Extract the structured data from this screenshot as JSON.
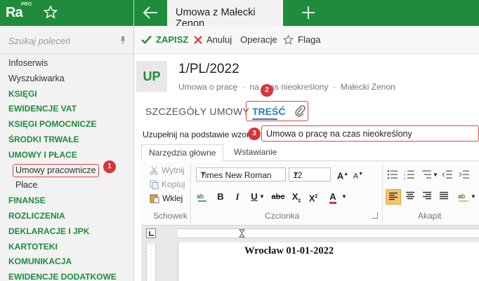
{
  "sidebar": {
    "logo": {
      "main": "Ra",
      "badge": "PRO"
    },
    "search_placeholder": "Szukaj poleceń",
    "items": [
      {
        "label": "Infoserwis",
        "style": "normal"
      },
      {
        "label": "Wyszukiwarka",
        "style": "normal"
      },
      {
        "label": "KSIĘGI",
        "style": "green"
      },
      {
        "label": "EWIDENCJE VAT",
        "style": "green"
      },
      {
        "label": "KSIĘGI POMOCNICZE",
        "style": "green"
      },
      {
        "label": "ŚRODKI TRWAŁE",
        "style": "green"
      },
      {
        "label": "UMOWY I PŁACE",
        "style": "green"
      },
      {
        "label": "Umowy pracownicze",
        "style": "sub-active"
      },
      {
        "label": "Płace",
        "style": "sub"
      },
      {
        "label": "FINANSE",
        "style": "green"
      },
      {
        "label": "ROZLICZENIA",
        "style": "green"
      },
      {
        "label": "DEKLARACJE I JPK",
        "style": "green"
      },
      {
        "label": "KARTOTEKI",
        "style": "green"
      },
      {
        "label": "KOMUNIKACJA",
        "style": "green"
      },
      {
        "label": "EWIDENCJE DODATKOWE",
        "style": "green"
      }
    ]
  },
  "tabs": {
    "active_tab": "Umowa z Małecki Zenon"
  },
  "toolbar": {
    "save": "ZAPISZ",
    "cancel": "Anuluj",
    "operations": "Operacje",
    "flag": "Flaga"
  },
  "header": {
    "badge": "UP",
    "number": "1/PL/2022",
    "subtitle_parts": [
      "Umowa o pracę",
      "na czas nieokreślony",
      "Małecki Zenon"
    ]
  },
  "section_tabs": {
    "details": "SZCZEGÓŁY UMOWY",
    "content": "TREŚĆ"
  },
  "template": {
    "label": "Uzupełnij na podstawie wzoru",
    "value": "Umowa o pracę na czas nieokreślony"
  },
  "callouts": [
    "1",
    "2",
    "3"
  ],
  "ribbon": {
    "tabs": [
      "Narzędzia główne",
      "Wstawianie"
    ],
    "clipboard": {
      "cut": "Wytnij",
      "copy": "Kopiuj",
      "paste": "Wklej",
      "group": "Schowek"
    },
    "font": {
      "family": "Times New Roman",
      "size": "12",
      "group": "Czcionka"
    },
    "paragraph": {
      "group": "Akapit"
    }
  },
  "document": {
    "first_line": "Wrocław 01-01-2022"
  },
  "colors": {
    "brand_green": "#1e8c3a",
    "callout_red": "#d8343a",
    "link_blue": "#2a7bbd"
  }
}
